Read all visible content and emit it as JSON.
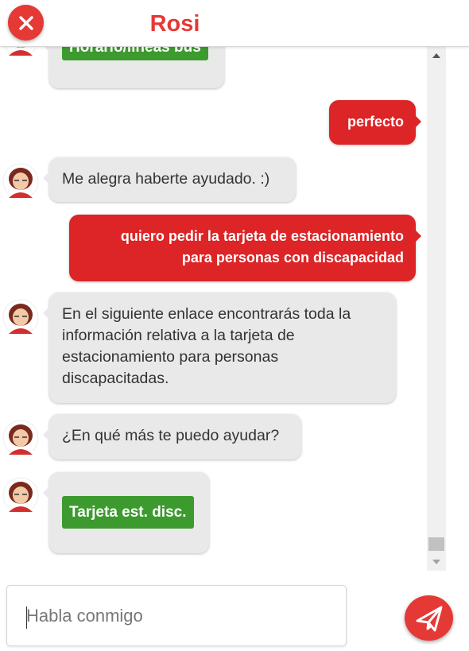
{
  "header": {
    "title": "Rosi",
    "close_icon": "close-icon",
    "accent_color": "#e53935"
  },
  "messages": [
    {
      "sender": "bot",
      "button": "Horario/líneas bus"
    },
    {
      "sender": "user",
      "text": "perfecto"
    },
    {
      "sender": "bot",
      "text": "Me alegra haberte ayudado. :)"
    },
    {
      "sender": "user",
      "lines": [
        "quiero pedir la tarjeta de estacionamiento",
        "para personas con discapacidad"
      ]
    },
    {
      "sender": "bot",
      "lines": [
        "En el siguiente enlace encontrarás toda la",
        "información relativa a la tarjeta de",
        "estacionamiento para personas",
        "discapacitadas."
      ]
    },
    {
      "sender": "bot",
      "text": "¿En qué más te puedo ayudar?"
    },
    {
      "sender": "bot",
      "button": "Tarjeta est. disc."
    }
  ],
  "composer": {
    "placeholder": "Habla conmigo",
    "send_icon": "paper-plane-icon"
  },
  "colors": {
    "user_bubble": "#dd2426",
    "bot_bubble": "#e9e9e9",
    "link_button": "#3c9a2e"
  }
}
